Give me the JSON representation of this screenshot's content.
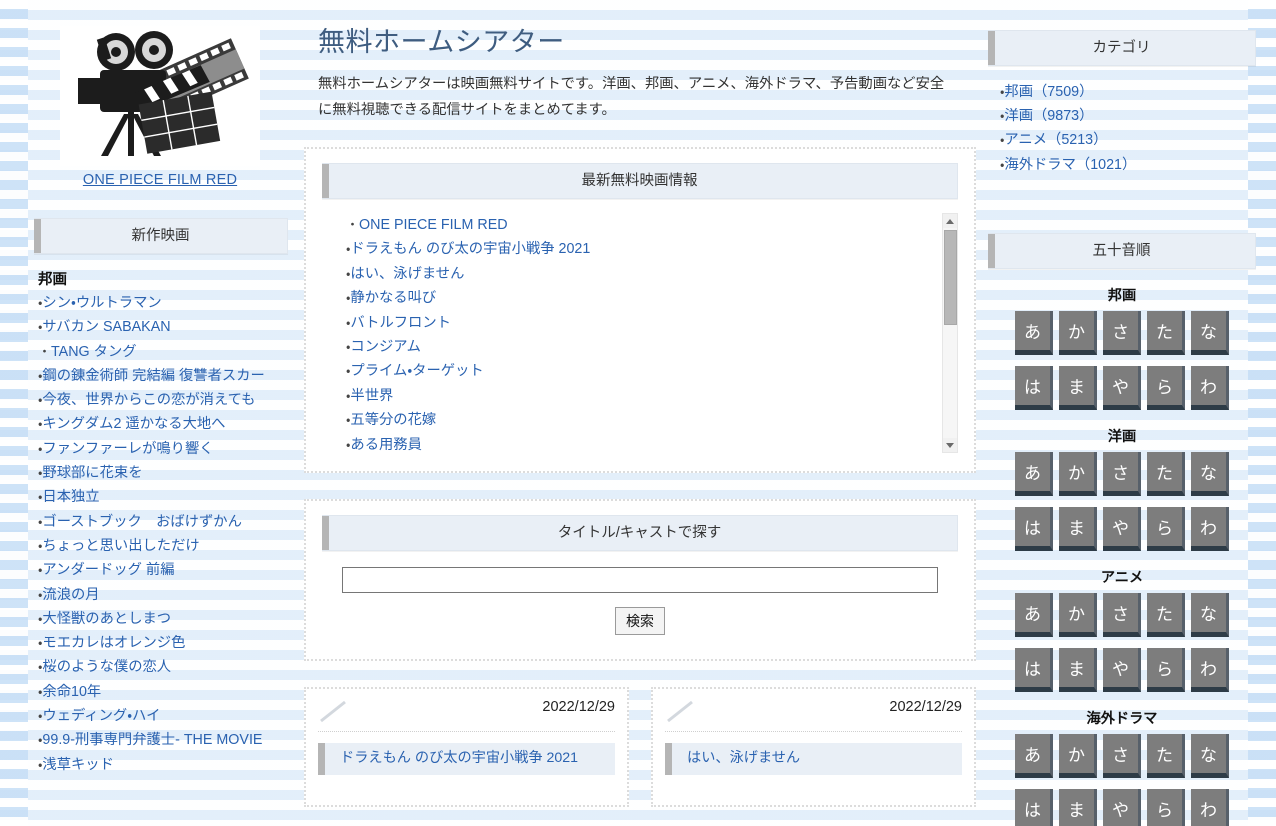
{
  "site": {
    "title": "無料ホームシアター",
    "description": "無料ホームシアターは映画無料サイトです。洋画、邦画、アニメ、海外ドラマ、予告動画など安全に無料視聴できる配信サイトをまとめてます。",
    "logo_icon": "movie-projector-icon",
    "logo_link_label": "ONE PIECE FILM RED"
  },
  "sidebar_left": {
    "header": "新作映画",
    "group_label": "邦画",
    "items": [
      "シン・ウルトラマン",
      "サバカン SABAKAN",
      "TANG タング",
      "鋼の錬金術師 完結編 復讐者スカー",
      "今夜、世界からこの恋が消えても",
      "キングダム2 遥かなる大地へ",
      "ファンファーレが鳴り響く",
      "野球部に花束を",
      "日本独立",
      "ゴーストブック　おばけずかん",
      "ちょっと思い出しただけ",
      "アンダードッグ 前編",
      "流浪の月",
      "大怪獣のあとしまつ",
      "モエカレはオレンジ色",
      "桜のような僕の恋人",
      "余命10年",
      "ウェディング・ハイ",
      "99.9-刑事専門弁護士- THE MOVIE",
      "浅草キッド"
    ]
  },
  "latest": {
    "header": "最新無料映画情報",
    "items": [
      "ONE PIECE FILM RED",
      "ドラえもん のび太の宇宙小戦争 2021",
      "はい、泳げません",
      "静かなる叫び",
      "バトルフロント",
      "コンジアム",
      "プライム・ターゲット",
      "半世界",
      "五等分の花嫁",
      "ある用務員"
    ],
    "scrollbar": {
      "up_icon": "triangle-up-icon",
      "down_icon": "triangle-down-icon"
    }
  },
  "search": {
    "header": "タイトル/キャストで探す",
    "value": "",
    "placeholder": "",
    "button_label": "検索"
  },
  "cards": [
    {
      "image_icon": "broken-image-icon",
      "date": "2022/12/29",
      "title": "ドラえもん のび太の宇宙小戦争 2021"
    },
    {
      "image_icon": "broken-image-icon",
      "date": "2022/12/29",
      "title": "はい、泳げません"
    }
  ],
  "categories": {
    "header": "カテゴリ",
    "items": [
      "邦画（7509）",
      "洋画（9873）",
      "アニメ（5213）",
      "海外ドラマ（1021）"
    ]
  },
  "kana": {
    "header": "五十音順",
    "row1": [
      "あ",
      "か",
      "さ",
      "た",
      "な"
    ],
    "row2": [
      "は",
      "ま",
      "や",
      "ら",
      "わ"
    ],
    "sections": [
      "邦画",
      "洋画",
      "アニメ",
      "海外ドラマ"
    ]
  },
  "colors": {
    "link": "#2a62b0",
    "panel_header_bg": "#e9eff6",
    "accent_bar": "#b5b5b5",
    "kana_button_bg": "#7d7d7d",
    "kana_button_shadow": "#2e3c47",
    "page_bg": "#f3f8fd"
  }
}
